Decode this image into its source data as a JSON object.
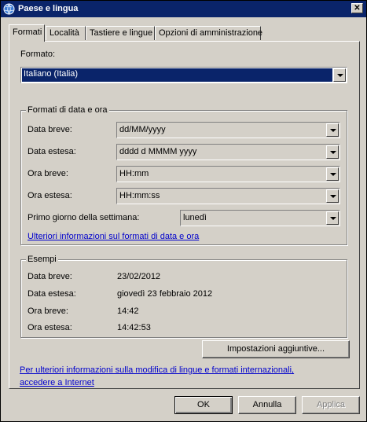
{
  "window": {
    "title": "Paese e lingua",
    "close_label": "✕"
  },
  "tabs": [
    {
      "label": "Formati",
      "active": true
    },
    {
      "label": "Località"
    },
    {
      "label": "Tastiere e lingue"
    },
    {
      "label": "Opzioni di amministrazione"
    }
  ],
  "format": {
    "label": "Formato:",
    "value": "Italiano (Italia)"
  },
  "date_time_group": {
    "title": "Formati di data e ora",
    "short_date": {
      "label": "Data breve:",
      "value": "dd/MM/yyyy"
    },
    "long_date": {
      "label": "Data estesa:",
      "value": "dddd d MMMM yyyy"
    },
    "short_time": {
      "label": "Ora breve:",
      "value": "HH:mm"
    },
    "long_time": {
      "label": "Ora estesa:",
      "value": "HH:mm:ss"
    },
    "first_day": {
      "label": "Primo giorno della settimana:",
      "value": "lunedì"
    },
    "more_info_link": "Ulteriori informazioni sul formati di data e ora"
  },
  "examples": {
    "title": "Esempi",
    "rows": [
      {
        "label": "Data breve:",
        "value": "23/02/2012"
      },
      {
        "label": "Data estesa:",
        "value": "giovedì 23 febbraio 2012"
      },
      {
        "label": "Ora breve:",
        "value": "14:42"
      },
      {
        "label": "Ora estesa:",
        "value": "14:42:53"
      }
    ]
  },
  "additional_settings_label": "Impostazioni aggiuntive...",
  "bottom_link_line1": "Per ulteriori informazioni sulla modifica di lingue e formati internazionali,",
  "bottom_link_line2": "accedere a Internet",
  "buttons": {
    "ok": "OK",
    "cancel": "Annulla",
    "apply": "Applica"
  },
  "colors": {
    "titlebar": "#0a246a",
    "face": "#d4d0c8",
    "link": "#0000cc",
    "selection": "#0a246a"
  },
  "icons": {
    "title": "globe-icon",
    "dropdown": "chevron-down-icon"
  }
}
